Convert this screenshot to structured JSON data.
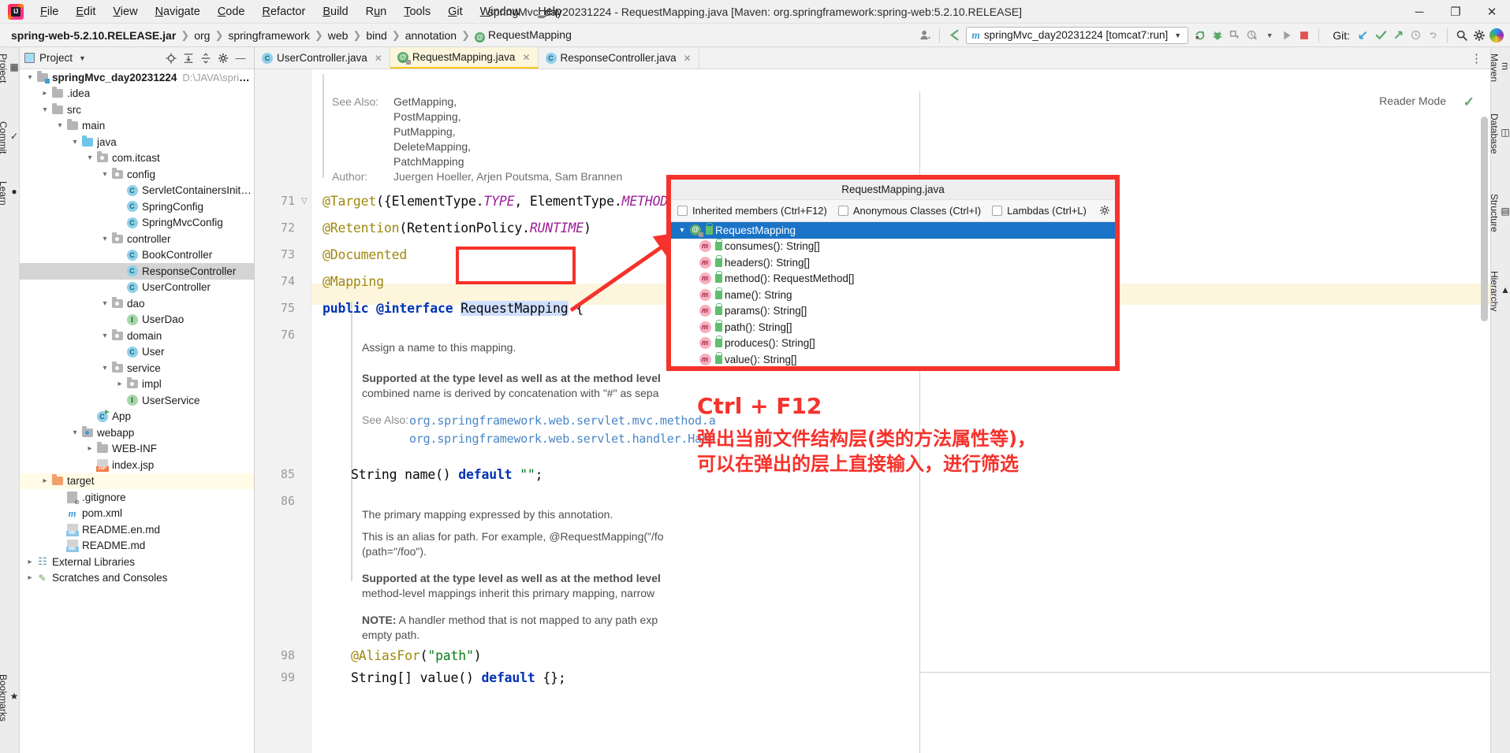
{
  "window": {
    "title": "springMvc_day20231224 - RequestMapping.java [Maven: org.springframework:spring-web:5.2.10.RELEASE]",
    "minimize": "─",
    "maximize": "❐",
    "close": "✕",
    "logo_text": "IJ"
  },
  "menubar": [
    "File",
    "Edit",
    "View",
    "Navigate",
    "Code",
    "Refactor",
    "Build",
    "Run",
    "Tools",
    "Git",
    "Window",
    "Help"
  ],
  "breadcrumb": {
    "items": [
      "spring-web-5.2.10.RELEASE.jar",
      "org",
      "springframework",
      "web",
      "bind",
      "annotation",
      "RequestMapping"
    ],
    "last_badge": "@"
  },
  "toolbar": {
    "run_config": "springMvc_day20231224 [tomcat7:run]",
    "run_config_prefix": "m",
    "git_label": "Git:",
    "icons": [
      "user-avatar-icon",
      "back-arrow-icon",
      "build-icon",
      "debug-icon",
      "coverage-icon",
      "profile-icon",
      "run-icon",
      "stop-icon"
    ],
    "git_icons": [
      "update-project-icon",
      "commit-icon",
      "push-icon",
      "history-icon",
      "rollback-icon"
    ],
    "right_icons": [
      "search-everywhere-icon",
      "settings-gear-icon",
      "rainbow-icon"
    ]
  },
  "left_rail": [
    "Project",
    "Commit",
    "Learn"
  ],
  "right_rail": [
    "Maven",
    "Database",
    "Structure",
    "Hierarchy"
  ],
  "bottom_rail": [
    "Bookmarks"
  ],
  "project_panel": {
    "title": "Project",
    "header_icons": [
      "locate-icon",
      "expand-all-icon",
      "collapse-all-icon",
      "settings-icon",
      "hide-icon"
    ],
    "tree": [
      {
        "depth": 0,
        "twisty": "v",
        "icon": "module-folder",
        "label": "springMvc_day20231224",
        "bold": true,
        "path": "D:\\JAVA\\springM",
        "state": "normal"
      },
      {
        "depth": 1,
        "twisty": ">",
        "icon": "folder-gray",
        "label": ".idea",
        "state": "normal"
      },
      {
        "depth": 1,
        "twisty": "v",
        "icon": "folder-gray",
        "label": "src",
        "state": "normal"
      },
      {
        "depth": 2,
        "twisty": "v",
        "icon": "folder-gray",
        "label": "main",
        "state": "normal"
      },
      {
        "depth": 3,
        "twisty": "v",
        "icon": "folder-blue",
        "label": "java",
        "state": "normal"
      },
      {
        "depth": 4,
        "twisty": "v",
        "icon": "package-icon",
        "label": "com.itcast",
        "state": "normal"
      },
      {
        "depth": 5,
        "twisty": "v",
        "icon": "package-icon",
        "label": "config",
        "state": "normal"
      },
      {
        "depth": 6,
        "twisty": "",
        "icon": "class-icon",
        "label": "ServletContainersInitCon",
        "state": "normal"
      },
      {
        "depth": 6,
        "twisty": "",
        "icon": "class-icon",
        "label": "SpringConfig",
        "state": "normal"
      },
      {
        "depth": 6,
        "twisty": "",
        "icon": "class-icon",
        "label": "SpringMvcConfig",
        "state": "normal"
      },
      {
        "depth": 5,
        "twisty": "v",
        "icon": "package-icon",
        "label": "controller",
        "state": "normal"
      },
      {
        "depth": 6,
        "twisty": "",
        "icon": "class-icon",
        "label": "BookController",
        "state": "normal"
      },
      {
        "depth": 6,
        "twisty": "",
        "icon": "class-icon",
        "label": "ResponseController",
        "state": "selected"
      },
      {
        "depth": 6,
        "twisty": "",
        "icon": "class-icon",
        "label": "UserController",
        "state": "normal"
      },
      {
        "depth": 5,
        "twisty": "v",
        "icon": "package-icon",
        "label": "dao",
        "state": "normal"
      },
      {
        "depth": 6,
        "twisty": "",
        "icon": "interface-icon",
        "label": "UserDao",
        "state": "normal"
      },
      {
        "depth": 5,
        "twisty": "v",
        "icon": "package-icon",
        "label": "domain",
        "state": "normal"
      },
      {
        "depth": 6,
        "twisty": "",
        "icon": "class-icon",
        "label": "User",
        "state": "normal"
      },
      {
        "depth": 5,
        "twisty": "v",
        "icon": "package-icon",
        "label": "service",
        "state": "normal"
      },
      {
        "depth": 6,
        "twisty": ">",
        "icon": "package-icon",
        "label": "impl",
        "state": "normal"
      },
      {
        "depth": 6,
        "twisty": "",
        "icon": "interface-icon",
        "label": "UserService",
        "state": "normal"
      },
      {
        "depth": 4,
        "twisty": "",
        "icon": "app-class-icon",
        "label": "App",
        "state": "normal"
      },
      {
        "depth": 3,
        "twisty": "v",
        "icon": "webapp-icon",
        "label": "webapp",
        "state": "normal"
      },
      {
        "depth": 4,
        "twisty": ">",
        "icon": "folder-gray",
        "label": "WEB-INF",
        "state": "normal"
      },
      {
        "depth": 4,
        "twisty": "",
        "icon": "jsp-icon",
        "label": "index.jsp",
        "state": "normal"
      },
      {
        "depth": 1,
        "twisty": ">",
        "icon": "folder-orange",
        "label": "target",
        "state": "highlight"
      },
      {
        "depth": 2,
        "twisty": "",
        "icon": "gitignore-icon",
        "label": ".gitignore",
        "state": "normal"
      },
      {
        "depth": 2,
        "twisty": "",
        "icon": "maven-icon",
        "label": "pom.xml",
        "state": "normal"
      },
      {
        "depth": 2,
        "twisty": "",
        "icon": "md-icon",
        "label": "README.en.md",
        "state": "normal"
      },
      {
        "depth": 2,
        "twisty": "",
        "icon": "md-icon",
        "label": "README.md",
        "state": "normal"
      },
      {
        "depth": 0,
        "twisty": ">",
        "icon": "libraries-icon",
        "label": "External Libraries",
        "state": "normal"
      },
      {
        "depth": 0,
        "twisty": ">",
        "icon": "scratches-icon",
        "label": "Scratches and Consoles",
        "state": "normal"
      }
    ]
  },
  "editor": {
    "tabs": [
      {
        "label": "UserController.java",
        "icon": "class-icon",
        "active": false
      },
      {
        "label": "RequestMapping.java",
        "icon": "annotation-icon",
        "active": true
      },
      {
        "label": "ResponseController.java",
        "icon": "class-icon",
        "active": false
      }
    ],
    "reader_mode": "Reader Mode",
    "javadoc": {
      "see_also_label": "See Also:",
      "see_also": [
        "GetMapping,",
        "PostMapping,",
        "PutMapping,",
        "DeleteMapping,",
        "PatchMapping"
      ],
      "author_label": "Author:",
      "author": "Juergen Hoeller, Arjen Poutsma, Sam Brannen"
    },
    "lines": [
      {
        "num": "71",
        "fold": "-",
        "text": "@Target({ElementType.TYPE, ElementType.METHOD})"
      },
      {
        "num": "72",
        "fold": "",
        "text": "@Retention(RetentionPolicy.RUNTIME)"
      },
      {
        "num": "73",
        "fold": "",
        "text": "@Documented"
      },
      {
        "num": "74",
        "fold": "",
        "text": "@Mapping"
      },
      {
        "num": "75",
        "fold": "",
        "text": "public @interface RequestMapping {"
      },
      {
        "num": "76",
        "fold": "",
        "text": ""
      },
      {
        "num": "85",
        "fold": "",
        "text": "String name() default \"\";"
      },
      {
        "num": "86",
        "fold": "",
        "text": ""
      },
      {
        "num": "98",
        "fold": "",
        "text": "@AliasFor(\"path\")"
      },
      {
        "num": "99",
        "fold": "",
        "text": "String[] value() default {};"
      }
    ],
    "doc_blocks": [
      {
        "type": "plain",
        "text": "Assign a name to this mapping."
      },
      {
        "type": "bold",
        "text": "Supported at the type level as well as at the method level"
      },
      {
        "type": "plain",
        "text": "combined name is derived by concatenation with \"#\" as sepa"
      },
      {
        "type": "label",
        "text": "See Also:"
      },
      {
        "type": "link",
        "text": "org.springframework.web.servlet.mvc.method.a"
      },
      {
        "type": "link",
        "text": "org.springframework.web.servlet.handler.Hand"
      },
      {
        "type": "plain",
        "text": "The primary mapping expressed by this annotation."
      },
      {
        "type": "plain",
        "text": "This is an alias for path. For example, @RequestMapping(\"/fo"
      },
      {
        "type": "plain",
        "text": "(path=\"/foo\")."
      },
      {
        "type": "bold",
        "text": "Supported at the type level as well as at the method level"
      },
      {
        "type": "plain",
        "text": "method-level mappings inherit this primary mapping, narrow"
      },
      {
        "type": "bold-note",
        "text": "NOTE:",
        "rest": " A handler method that is not mapped to any path exp"
      },
      {
        "type": "plain",
        "text": "empty path."
      }
    ],
    "highlighted_symbol": "RequestMapping"
  },
  "structure_popup": {
    "title": "RequestMapping.java",
    "filters": [
      {
        "label": "Inherited members (Ctrl+F12)",
        "checked": false
      },
      {
        "label": "Anonymous Classes (Ctrl+I)",
        "checked": false
      },
      {
        "label": "Lambdas (Ctrl+L)",
        "checked": false
      }
    ],
    "settings_icon": "gear-icon",
    "root": {
      "label": "RequestMapping",
      "icon": "annotation-icon",
      "twisty": "v",
      "selected": true
    },
    "members": [
      {
        "label": "consumes(): String[]",
        "icon": "method-icon",
        "visibility": "public-lock-icon"
      },
      {
        "label": "headers(): String[]",
        "icon": "method-icon",
        "visibility": "public-lock-icon"
      },
      {
        "label": "method(): RequestMethod[]",
        "icon": "method-icon",
        "visibility": "public-lock-icon"
      },
      {
        "label": "name(): String",
        "icon": "method-icon",
        "visibility": "public-lock-icon"
      },
      {
        "label": "params(): String[]",
        "icon": "method-icon",
        "visibility": "public-lock-icon"
      },
      {
        "label": "path(): String[]",
        "icon": "method-icon",
        "visibility": "public-lock-icon"
      },
      {
        "label": "produces(): String[]",
        "icon": "method-icon",
        "visibility": "public-lock-icon"
      },
      {
        "label": "value(): String[]",
        "icon": "method-icon",
        "visibility": "public-lock-icon"
      }
    ]
  },
  "annotation": {
    "shortcut": "Ctrl + F12",
    "line1": "弹出当前文件结构层(类的方法属性等)，",
    "line2": "可以在弹出的层上直接输入，进行筛选",
    "color": "#f5322b"
  }
}
